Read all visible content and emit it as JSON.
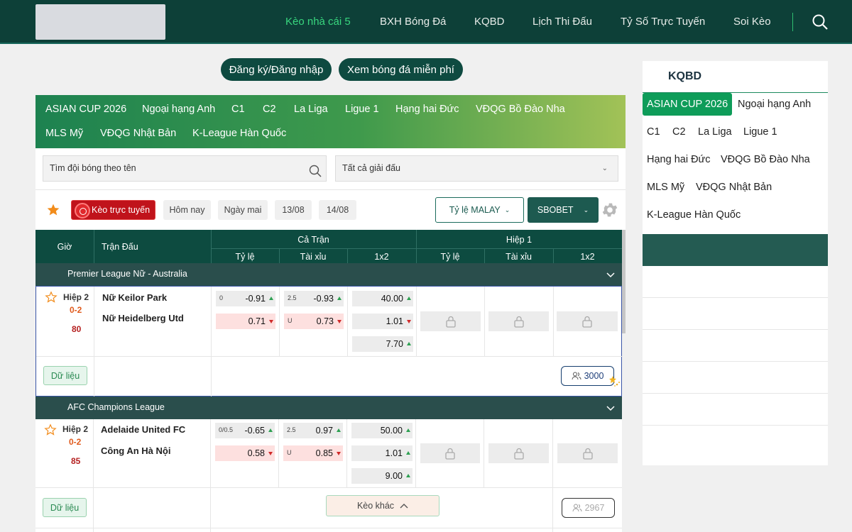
{
  "header": {
    "nav": [
      {
        "label": "Kèo nhà cái 5",
        "active": true
      },
      {
        "label": "BXH Bóng Đá",
        "active": false
      },
      {
        "label": "KQBD",
        "active": false
      },
      {
        "label": "Lịch Thi Đấu",
        "active": false
      },
      {
        "label": "Tỷ Số Trực Tuyến",
        "active": false
      },
      {
        "label": "Soi Kèo",
        "active": false
      }
    ]
  },
  "actions": {
    "login": "Đăng ký/Đăng nhập",
    "watch": "Xem bóng đá miễn phí"
  },
  "league_tabs": [
    "ASIAN CUP 2026",
    "Ngoại hạng Anh",
    "C1",
    "C2",
    "La Liga",
    "Ligue 1",
    "Hạng hai Đức",
    "VĐQG Bồ Đào Nha",
    "MLS Mỹ",
    "VĐQG Nhật Bản",
    "K-League Hàn Quốc"
  ],
  "filters": {
    "search_placeholder": "Tìm đội bóng theo tên",
    "league_select": "Tất cả giải đấu",
    "live": "Kèo trực tuyến",
    "days": [
      "Hôm nay",
      "Ngày mai",
      "13/08",
      "14/08"
    ],
    "odds_type": "Tỷ lệ MALAY",
    "bookmaker": "SBOBET"
  },
  "table_header": {
    "time": "Giờ",
    "match": "Trận Đấu",
    "full": "Cả Trận",
    "half": "Hiệp 1",
    "handicap": "Tỷ lệ",
    "overunder": "Tài xỉu",
    "x12": "1x2"
  },
  "leagues": [
    {
      "name": "Premier League Nữ - Australia",
      "match": {
        "status": "Hiệp 2",
        "score": "0-2",
        "minute": "80",
        "home": "Nữ Keilor Park",
        "away": "Nữ Heidelberg Utd",
        "hdp_line": "0",
        "hdp_home": "-0.91",
        "hdp_away": "0.71",
        "ou_line": "2.5",
        "ou_under": "U",
        "ou_over": "-0.93",
        "ou_under_val": "0.73",
        "x12": [
          "40.00",
          "1.01",
          "7.70"
        ],
        "data_label": "Dữ liệu",
        "viewers": "3000"
      }
    },
    {
      "name": "AFC Champions League",
      "match": {
        "status": "Hiệp 2",
        "score": "0-2",
        "minute": "85",
        "home": "Adelaide United FC",
        "away": "Công An Hà Nội",
        "hdp_line": "0/0.5",
        "hdp_home": "-0.65",
        "hdp_away": "0.58",
        "ou_line": "2.5",
        "ou_under": "U",
        "ou_over": "0.97",
        "ou_under_val": "0.85",
        "x12": [
          "50.00",
          "1.01",
          "9.00"
        ],
        "data_label": "Dữ liệu",
        "more_label": "Kèo khác",
        "viewers": "2967"
      }
    }
  ],
  "sidebar": {
    "title": "KQBD",
    "tags": [
      "ASIAN CUP 2026",
      "Ngoại hạng Anh",
      "C1",
      "C2",
      "La Liga",
      "Ligue 1",
      "Hạng hai Đức",
      "VĐQG Bồ Đào Nha",
      "MLS Mỹ",
      "VĐQG Nhật Bản",
      "K-League Hàn Quốc"
    ]
  }
}
